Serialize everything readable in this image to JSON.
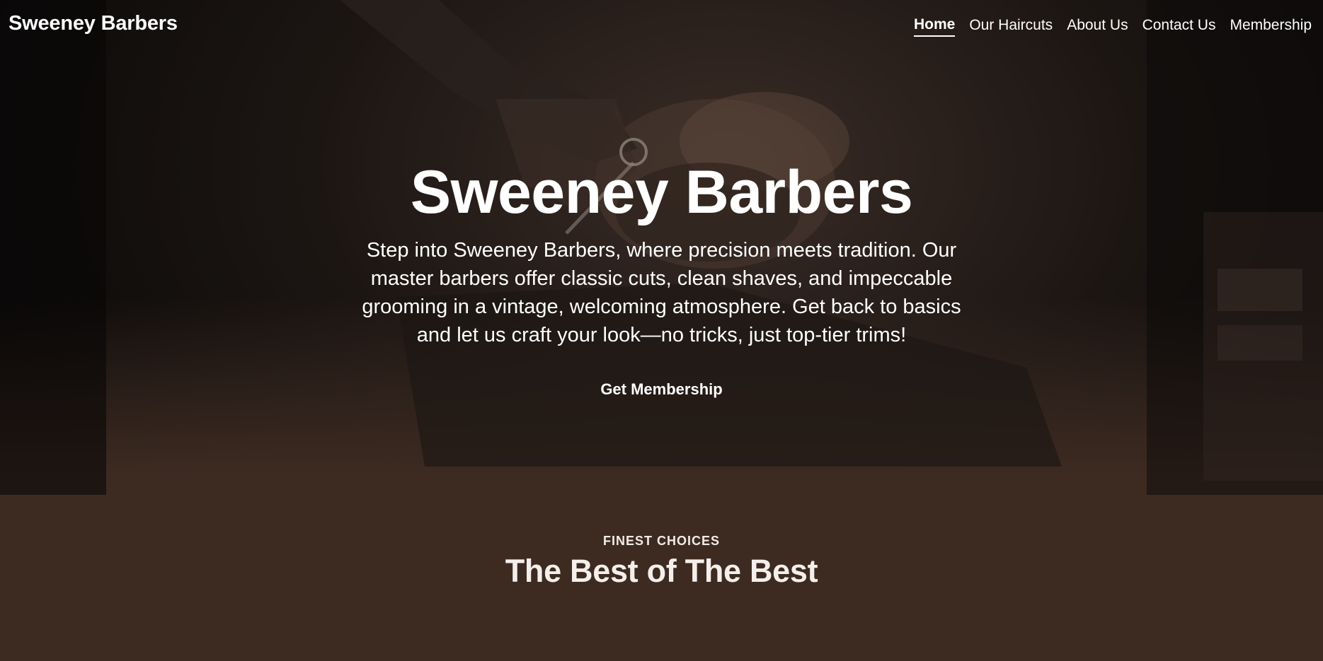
{
  "brand": {
    "name": "Sweeney Barbers"
  },
  "nav": {
    "items": [
      {
        "label": "Home",
        "active": true
      },
      {
        "label": "Our Haircuts",
        "active": false
      },
      {
        "label": "About Us",
        "active": false
      },
      {
        "label": "Contact Us",
        "active": false
      },
      {
        "label": "Membership",
        "active": false
      }
    ]
  },
  "hero": {
    "title": "Sweeney Barbers",
    "text": "Step into Sweeney Barbers, where precision meets tradition. Our master barbers offer classic cuts, clean shaves, and impeccable grooming in a vintage, welcoming atmosphere. Get back to basics and let us craft your look—no tricks, just top-tier trims!",
    "cta_label": "Get Membership"
  },
  "section": {
    "eyebrow": "FINEST CHOICES",
    "title": "The Best of The Best"
  },
  "colors": {
    "background": "#3d2b22",
    "text": "#ffffff"
  }
}
